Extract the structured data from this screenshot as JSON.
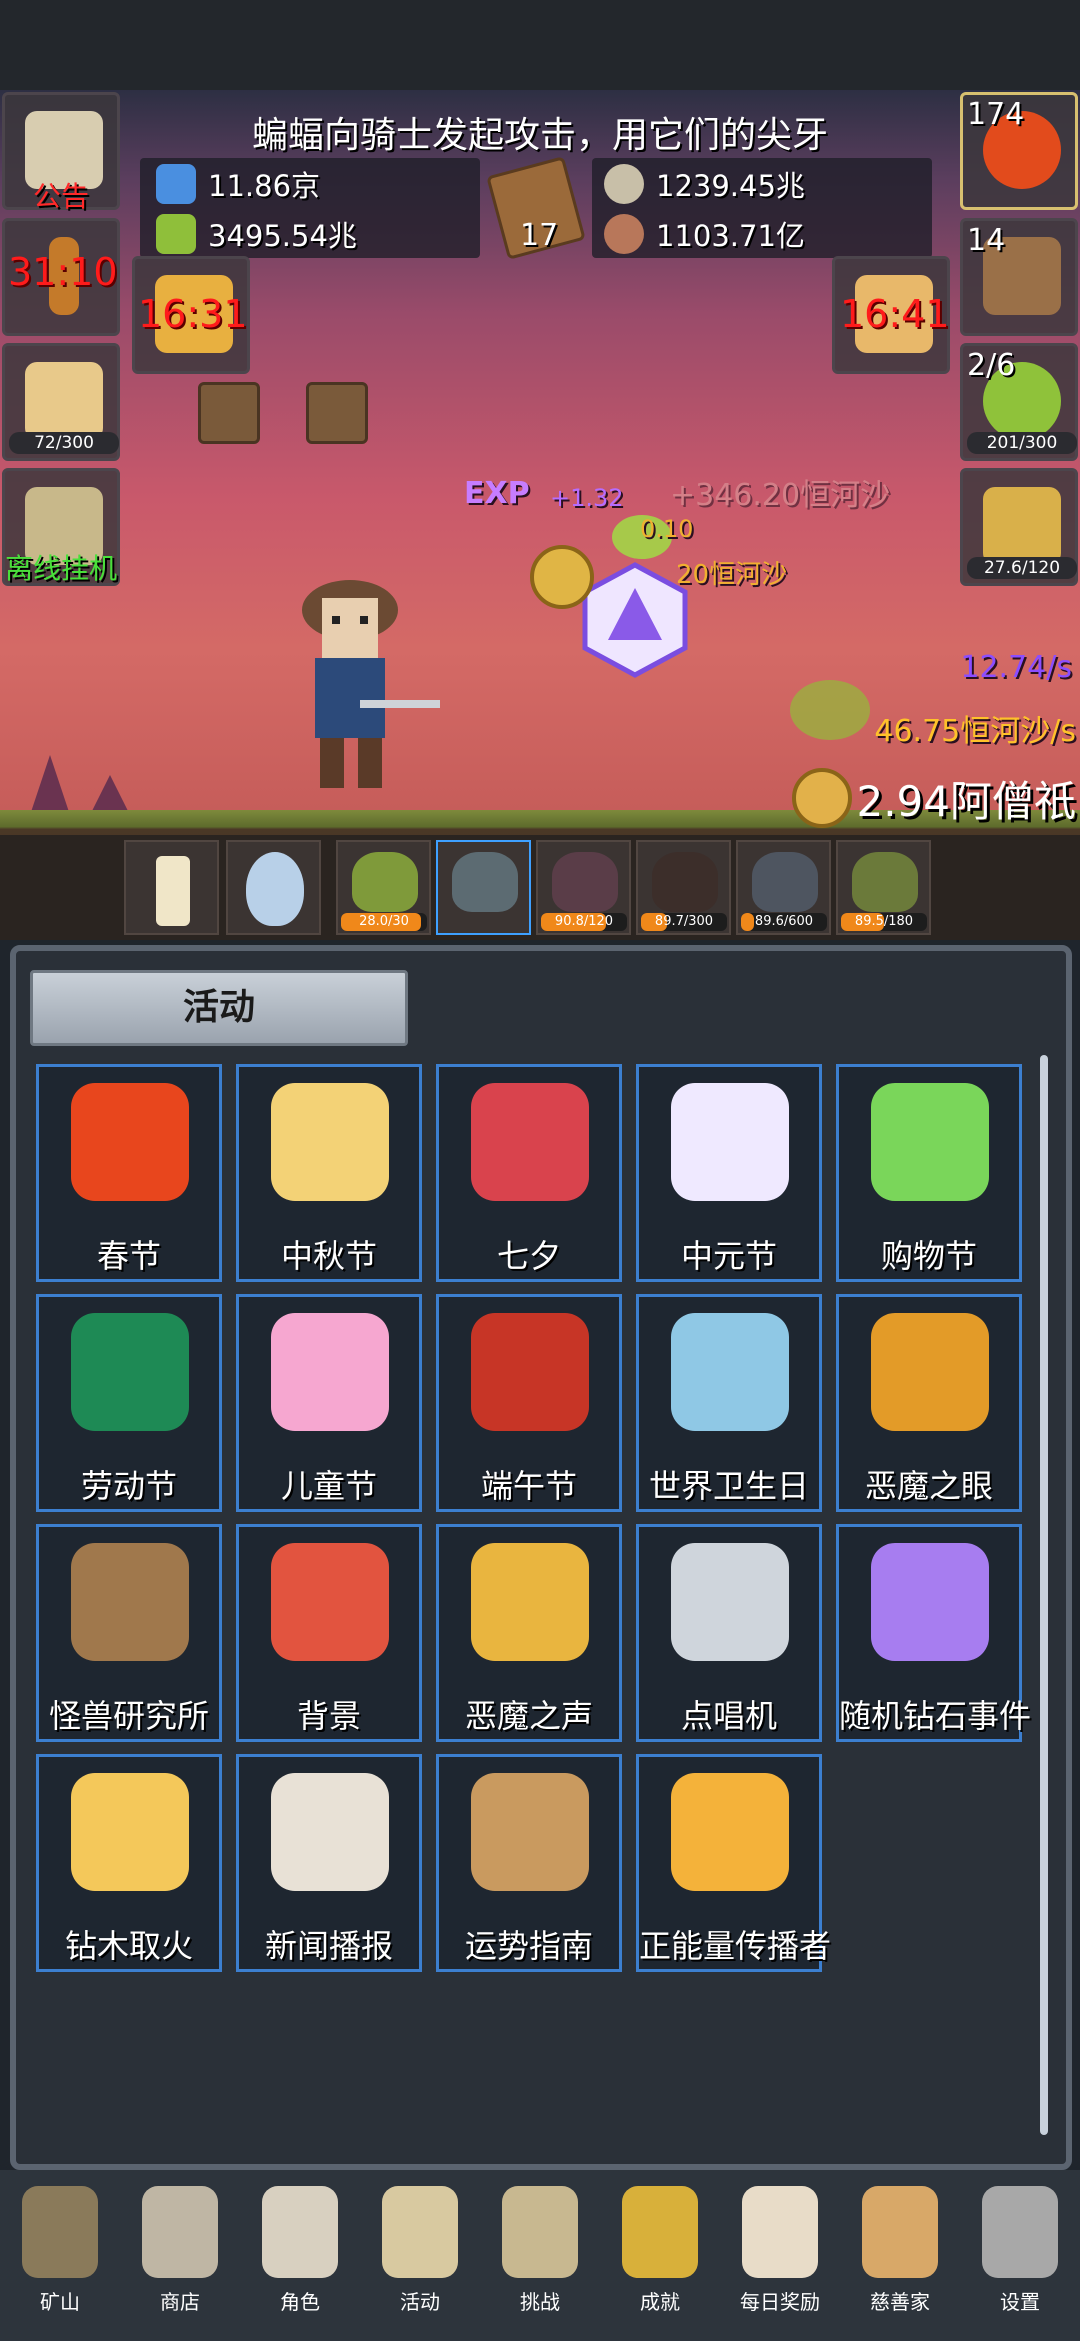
{
  "top_notice": "蝙蝠向骑士发起攻击，用它们的尖牙",
  "resources": {
    "blue_potion": "11.86京",
    "green_potion": "3495.54兆",
    "book_count": "17",
    "stone": "1239.45兆",
    "meat": "1103.71亿"
  },
  "left_side": {
    "notice_label": "公告",
    "torch_timer": "31:10",
    "beer_bar": "72/300",
    "offline_label": "离线挂机"
  },
  "right_side": {
    "potion_count": "174",
    "chest_count": "14",
    "slime_count": "2/6",
    "slime_bar": "201/300",
    "sword_bar": "27.6/120"
  },
  "timers": {
    "cake_timer": "16:31",
    "bread_timer": "16:41"
  },
  "battle": {
    "exp_label": "EXP",
    "exp_gain": "+1.32",
    "float_gold_1": "+346.20恒河沙",
    "float_gold_2": "20恒河沙",
    "float_small": "0.10",
    "rate_purple": "12.74/s",
    "rate_gold": "46.75恒河沙/s",
    "money": "2.94阿僧祇"
  },
  "monsters": [
    {
      "name": "slime",
      "bar": "28.0/30",
      "progress": 0.93
    },
    {
      "name": "zombie",
      "bar": "",
      "progress": 0
    },
    {
      "name": "bat",
      "bar": "90.8/120",
      "progress": 0.76
    },
    {
      "name": "spider",
      "bar": "89.7/300",
      "progress": 0.3
    },
    {
      "name": "ghost",
      "bar": "89.6/600",
      "progress": 0.15
    },
    {
      "name": "orc",
      "bar": "89.5/180",
      "progress": 0.5
    }
  ],
  "panel": {
    "title": "活动",
    "cards": [
      {
        "label": "春节",
        "icon": "lantern-icon",
        "color": "#e8461d"
      },
      {
        "label": "中秋节",
        "icon": "moon-icon",
        "color": "#f3d276"
      },
      {
        "label": "七夕",
        "icon": "heart-icon",
        "color": "#d9434d"
      },
      {
        "label": "中元节",
        "icon": "ghost-icon",
        "color": "#efe9ff"
      },
      {
        "label": "购物节",
        "icon": "cash-icon",
        "color": "#7ad65a"
      },
      {
        "label": "劳动节",
        "icon": "brush-icon",
        "color": "#1e8a55"
      },
      {
        "label": "儿童节",
        "icon": "lollipop-icon",
        "color": "#f6a7d0"
      },
      {
        "label": "端午节",
        "icon": "dragon-mask-icon",
        "color": "#c73526"
      },
      {
        "label": "世界卫生日",
        "icon": "ambulance-icon",
        "color": "#8fc8e5"
      },
      {
        "label": "恶魔之眼",
        "icon": "demon-eye-icon",
        "color": "#e39b28"
      },
      {
        "label": "怪兽研究所",
        "icon": "research-box-icon",
        "color": "#a0784c"
      },
      {
        "label": "背景",
        "icon": "sunset-icon",
        "color": "#e2543f"
      },
      {
        "label": "恶魔之声",
        "icon": "bell-icon",
        "color": "#e9b53f"
      },
      {
        "label": "点唱机",
        "icon": "cassette-icon",
        "color": "#cfd5dc"
      },
      {
        "label": "随机钻石事件",
        "icon": "diamond-icon",
        "color": "#a77df0"
      },
      {
        "label": "钻木取火",
        "icon": "fire-stick-icon",
        "color": "#f4c85a"
      },
      {
        "label": "新闻播报",
        "icon": "newspaper-icon",
        "color": "#e8e1d6"
      },
      {
        "label": "运势指南",
        "icon": "fortune-book-icon",
        "color": "#c99a5f"
      },
      {
        "label": "正能量传播者",
        "icon": "crown-icon",
        "color": "#f4b23a"
      }
    ]
  },
  "nav": [
    {
      "label": "矿山",
      "icon": "lantern-nav-icon"
    },
    {
      "label": "商店",
      "icon": "stone-nav-icon"
    },
    {
      "label": "角色",
      "icon": "skull-nav-icon"
    },
    {
      "label": "活动",
      "icon": "scroll-nav-icon"
    },
    {
      "label": "挑战",
      "icon": "map-nav-icon"
    },
    {
      "label": "成就",
      "icon": "key-nav-icon"
    },
    {
      "label": "每日奖励",
      "icon": "letter-nav-icon"
    },
    {
      "label": "慈善家",
      "icon": "bread-nav-icon"
    },
    {
      "label": "设置",
      "icon": "gear-nav-icon"
    }
  ]
}
